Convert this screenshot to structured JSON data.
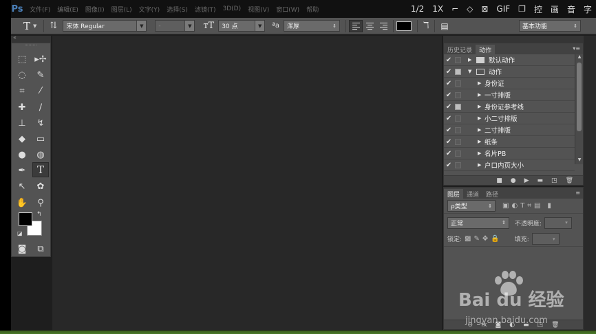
{
  "app": {
    "logo": "Ps"
  },
  "menu": [
    "文件(F)",
    "编辑(E)",
    "图像(I)",
    "图层(L)",
    "文字(Y)",
    "选择(S)",
    "滤镜(T)",
    "3D(D)",
    "视图(V)",
    "窗口(W)",
    "帮助"
  ],
  "menu_right": [
    "1/2",
    "1X",
    "GIF",
    "控",
    "画",
    "音",
    "字"
  ],
  "options": {
    "font_family": "宋体 Regular",
    "font_style": "-",
    "font_size": "30 点",
    "aa_label": "ªa",
    "aa_method": "浑厚",
    "workspace": "基本功能",
    "text_color": "#000000"
  },
  "actions_panel": {
    "tabs": [
      "历史记录",
      "动作"
    ],
    "active_tab": "动作",
    "items": [
      {
        "label": "默认动作",
        "type": "set",
        "expanded": false,
        "dialog": false
      },
      {
        "label": "动作",
        "type": "set",
        "expanded": true,
        "dialog": true
      },
      {
        "label": "身份证",
        "type": "action",
        "dialog": false
      },
      {
        "label": "一寸排版",
        "type": "action",
        "dialog": false
      },
      {
        "label": "身份证参考线",
        "type": "action",
        "dialog": true
      },
      {
        "label": "小二寸排版",
        "type": "action",
        "dialog": false
      },
      {
        "label": "二寸排版",
        "type": "action",
        "dialog": false
      },
      {
        "label": "纸条",
        "type": "action",
        "dialog": false
      },
      {
        "label": "名片PB",
        "type": "action",
        "dialog": false
      },
      {
        "label": "户口内页大小",
        "type": "action",
        "dialog": false
      }
    ]
  },
  "layers_panel": {
    "tabs": [
      "图层",
      "通道",
      "路径"
    ],
    "active_tab": "图层",
    "filter_label": "ρ类型",
    "blend_mode": "正常",
    "opacity_label": "不透明度:",
    "lock_label": "锁定:",
    "fill_label": "填充:"
  },
  "watermark": {
    "brand": "Bai du 经验",
    "url": "jingyan.baidu.com"
  }
}
